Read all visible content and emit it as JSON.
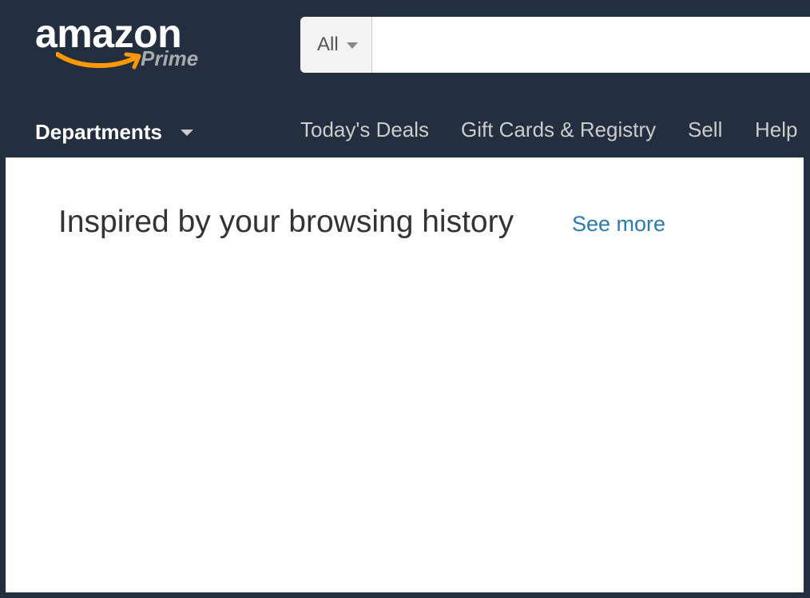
{
  "logo": {
    "wordmark": "amazon",
    "sub": "Prime",
    "accent_color": "#ff9900"
  },
  "search": {
    "category": "All",
    "value": "",
    "placeholder": ""
  },
  "nav": {
    "departments": "Departments",
    "items": [
      {
        "label": "Today's Deals"
      },
      {
        "label": "Gift Cards & Registry"
      },
      {
        "label": "Sell"
      },
      {
        "label": "Help"
      }
    ]
  },
  "main": {
    "section_title": "Inspired by your browsing history",
    "see_more": "See more"
  },
  "colors": {
    "header_bg": "#232f3e",
    "link": "#2a7aaf",
    "nav_text": "#cccccc"
  },
  "icons": {
    "search_category_caret": "caret-down-icon",
    "departments_caret": "caret-down-icon",
    "logo_smile": "amazon-smile-arrow-icon"
  }
}
